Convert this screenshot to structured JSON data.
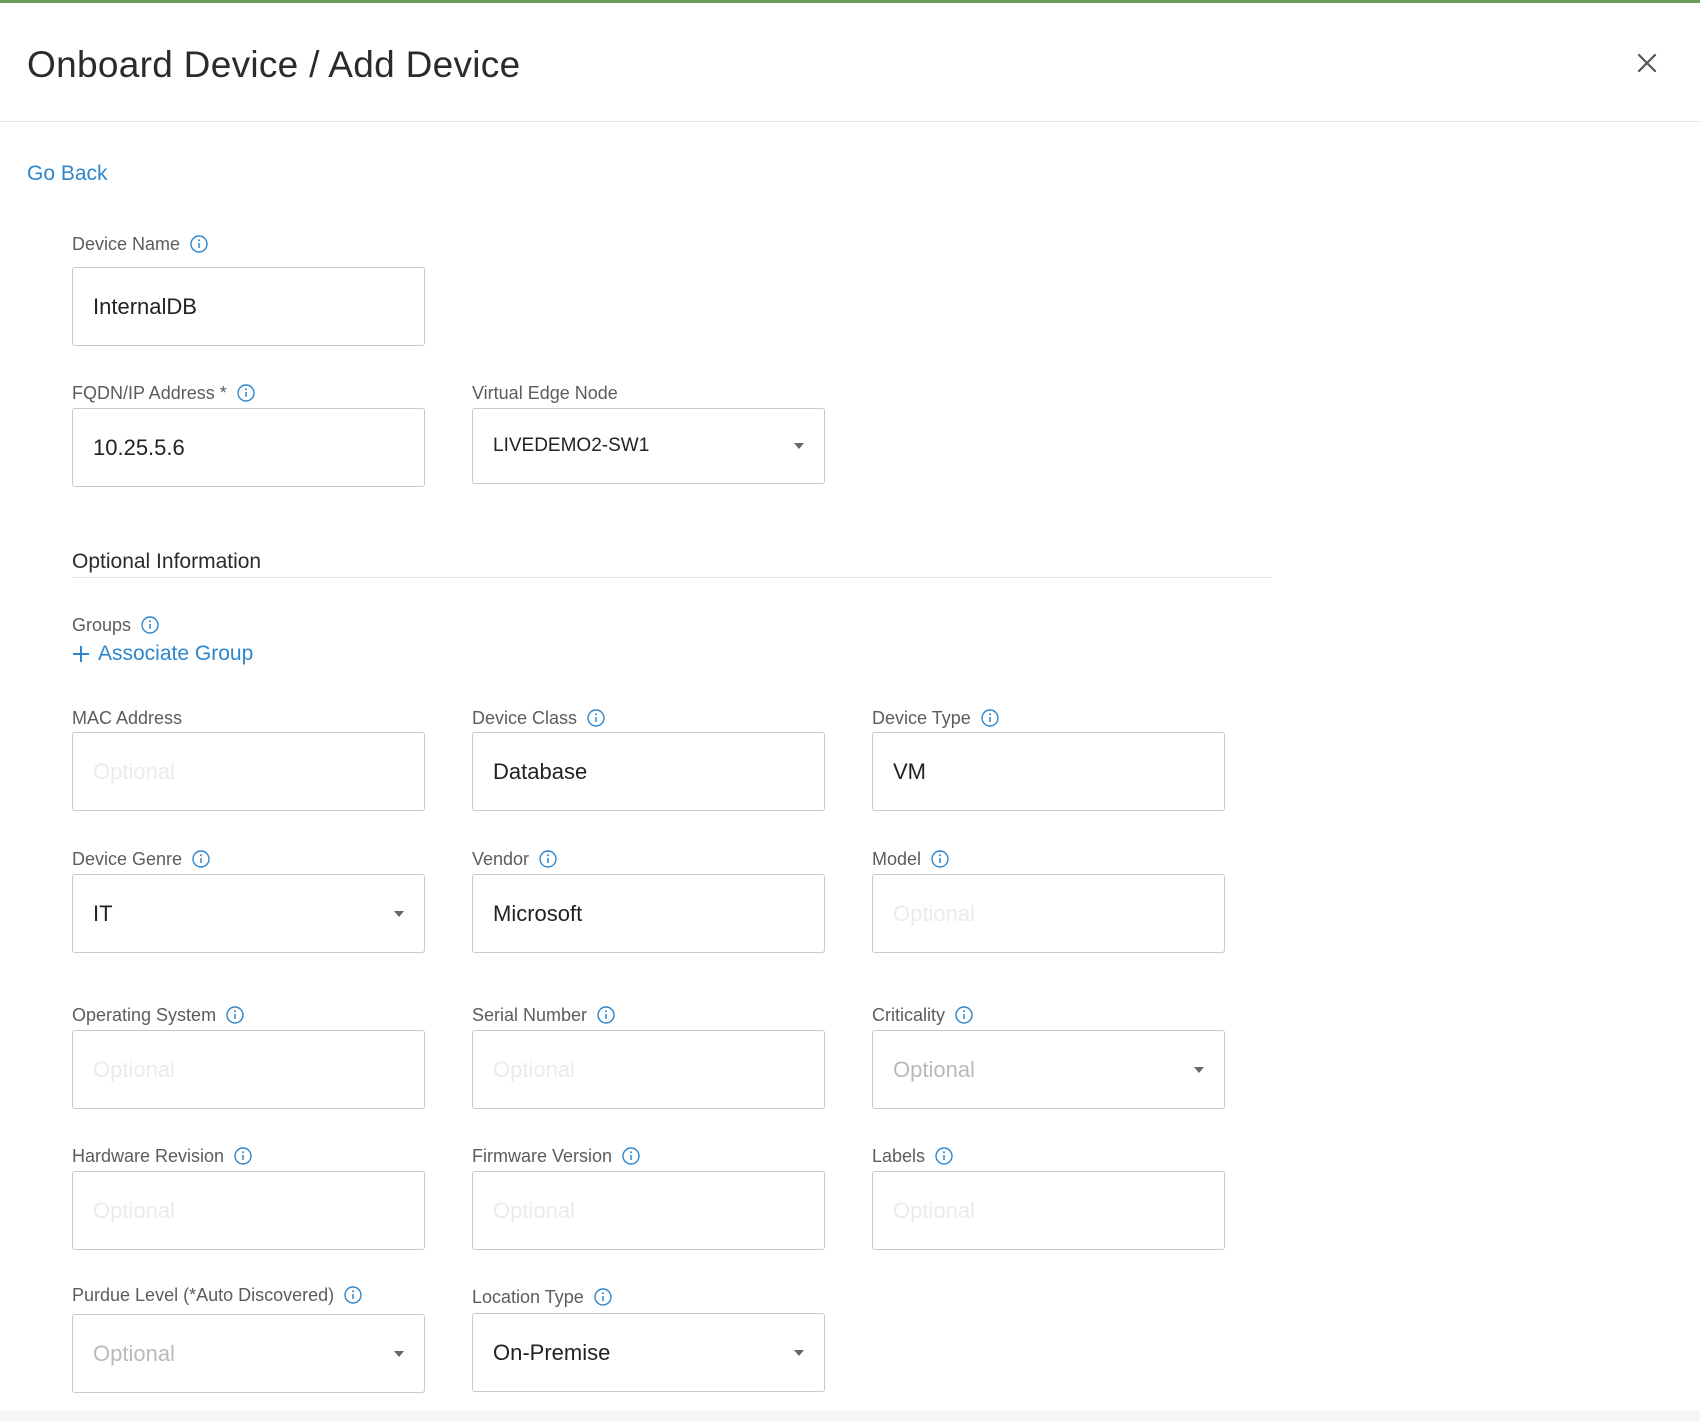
{
  "header": {
    "title": "Onboard Device / Add Device"
  },
  "nav": {
    "go_back": "Go Back"
  },
  "fields": {
    "device_name": {
      "label": "Device Name",
      "value": "InternalDB"
    },
    "fqdn": {
      "label": "FQDN/IP Address *",
      "value": "10.25.5.6"
    },
    "virtual_edge_node": {
      "label": "Virtual Edge Node",
      "value": "LIVEDEMO2-SW1"
    }
  },
  "optional": {
    "section_title": "Optional Information",
    "groups_label": "Groups",
    "associate_group": "Associate Group",
    "placeholder": "Optional",
    "mac_address": {
      "label": "MAC Address",
      "value": ""
    },
    "device_class": {
      "label": "Device Class",
      "value": "Database"
    },
    "device_type": {
      "label": "Device Type",
      "value": "VM"
    },
    "device_genre": {
      "label": "Device Genre",
      "value": "IT"
    },
    "vendor": {
      "label": "Vendor",
      "value": "Microsoft"
    },
    "model": {
      "label": "Model",
      "value": ""
    },
    "operating_system": {
      "label": "Operating System",
      "value": ""
    },
    "serial_number": {
      "label": "Serial Number",
      "value": ""
    },
    "criticality": {
      "label": "Criticality",
      "value": "Optional"
    },
    "hardware_revision": {
      "label": "Hardware Revision",
      "value": ""
    },
    "firmware_version": {
      "label": "Firmware Version",
      "value": ""
    },
    "labels": {
      "label": "Labels",
      "value": ""
    },
    "purdue_level": {
      "label": "Purdue Level (*Auto Discovered)",
      "value": "Optional"
    },
    "location_type": {
      "label": "Location Type",
      "value": "On-Premise"
    }
  },
  "icons": {
    "close": "close-icon",
    "info": "info-icon",
    "caret": "caret-down-icon",
    "plus": "plus-icon"
  },
  "colors": {
    "accent_link": "#2f86cc",
    "top_border": "#6e9b5b",
    "input_border": "#c9c9c9"
  }
}
